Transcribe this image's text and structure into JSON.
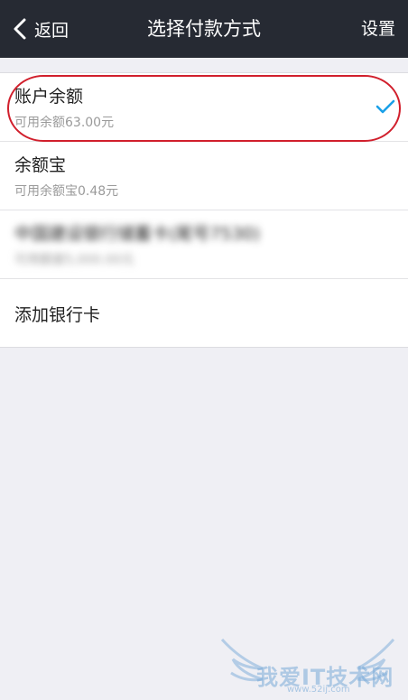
{
  "header": {
    "back_label": "返回",
    "title": "选择付款方式",
    "settings_label": "设置"
  },
  "payment_methods": [
    {
      "name": "账户余额",
      "detail": "可用余额63.00元",
      "selected": true
    },
    {
      "name": "余额宝",
      "detail": "可用余额宝0.48元",
      "selected": false
    },
    {
      "name": "中国建设银行储蓄卡(尾号7530)",
      "detail": "可用额度5,000.00元",
      "selected": false,
      "obscured": true
    }
  ],
  "add_card_label": "添加银行卡",
  "colors": {
    "topbar": "#262a33",
    "background": "#efeff4",
    "check": "#1aa0e8",
    "annotation": "#d11f2c"
  },
  "watermark": {
    "text": "我爱IT技术网",
    "url": "www.52ij.com"
  }
}
